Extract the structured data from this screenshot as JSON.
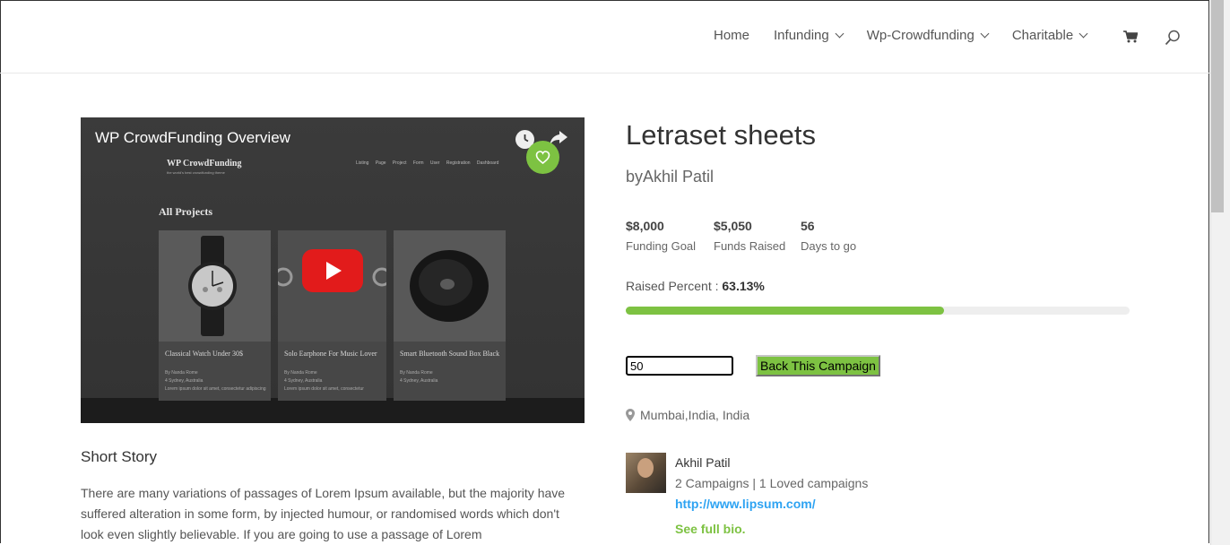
{
  "nav": {
    "home": "Home",
    "infunding": "Infunding",
    "wp_crowdfunding": "Wp-Crowdfunding",
    "charitable": "Charitable",
    "cart_icon": "cart-icon",
    "search_icon": "search-icon"
  },
  "video": {
    "title": "WP CrowdFunding Overview",
    "preview": {
      "logo": "WP CrowdFunding",
      "tagline": "the world's best crowdfunding theme",
      "menu": "Listing Page   Project Form   User Registration   Dashboard",
      "heading": "All Projects",
      "cards": [
        {
          "title": "Classical Watch Under 30$",
          "meta": "By Nanda Rome\n4 Sydney, Australia\nLorem ipsum dolor sit amet, consectetur adipiscing"
        },
        {
          "title": "Solo Earphone For Music Lover",
          "meta": "By Nanda Rome\n4 Sydney, Australia\nLorem ipsum dolor sit amet, consectetur"
        },
        {
          "title": "Smart Bluetooth Sound Box Black",
          "meta": "By Nanda Rome\n4 Sydney, Australia"
        }
      ]
    }
  },
  "story": {
    "heading": "Short Story",
    "text": "There are many variations of passages of Lorem Ipsum available, but the majority have suffered alteration in some form, by injected humour, or randomised words which don't look even slightly believable. If you are going to use a passage of Lorem"
  },
  "campaign": {
    "title": "Letraset sheets",
    "byline": "byAkhil Patil",
    "stats": [
      {
        "value": "$8,000",
        "label": "Funding Goal"
      },
      {
        "value": "$5,050",
        "label": "Funds Raised"
      },
      {
        "value": "56",
        "label": "Days to go"
      }
    ],
    "raised_label": "Raised Percent : ",
    "raised_value": "63.13%",
    "raised_fraction": 0.6313,
    "amount_value": "50",
    "back_button": "Back This Campaign",
    "location": "Mumbai,India, India"
  },
  "author": {
    "name": "Akhil Patil",
    "stats": "2 Campaigns | 1 Loved campaigns",
    "url": "http://www.lipsum.com/",
    "bio_link": "See full bio."
  },
  "colors": {
    "accent": "#7dc242",
    "link": "#2ea3f2",
    "play": "#e21b1b"
  }
}
